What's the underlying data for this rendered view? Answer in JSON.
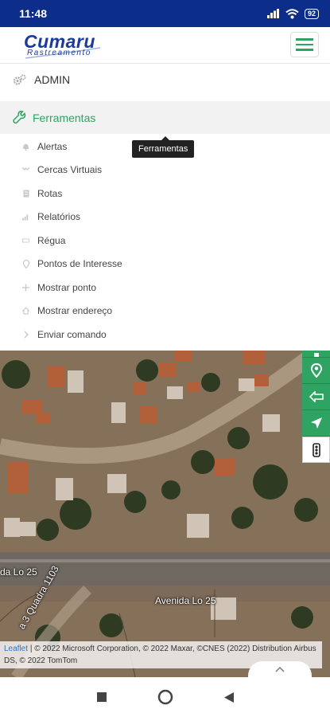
{
  "status": {
    "time": "11:48",
    "battery": "92"
  },
  "header": {
    "logo_main": "Cumaru",
    "logo_sub": "Rastreamento"
  },
  "menu": {
    "admin_label": "ADMIN",
    "tools_label": "Ferramentas",
    "tooltip": "Ferramentas",
    "items": [
      {
        "label": "Alertas",
        "icon": "bell-icon"
      },
      {
        "label": "Cercas Virtuais",
        "icon": "fence-icon"
      },
      {
        "label": "Rotas",
        "icon": "route-icon"
      },
      {
        "label": "Relatórios",
        "icon": "chart-icon"
      },
      {
        "label": "Régua",
        "icon": "ruler-icon"
      },
      {
        "label": "Pontos de Interesse",
        "icon": "pin-icon"
      },
      {
        "label": "Mostrar ponto",
        "icon": "crosshair-icon"
      },
      {
        "label": "Mostrar endereço",
        "icon": "home-icon"
      },
      {
        "label": "Enviar comando",
        "icon": "chevron-right-icon"
      }
    ]
  },
  "map": {
    "street_label_1": "da Lo 25",
    "street_label_2": "Avenida Lo 25",
    "street_label_3": "a 3 Quadra 1103",
    "attribution_link": "Leaflet",
    "attribution_text": "| © 2022 Microsoft Corporation, © 2022 Maxar, ©CNES (2022) Distribution Airbus DS, © 2022 TomTom"
  },
  "colors": {
    "brand_blue": "#1b3a9c",
    "accent_green": "#2fa361",
    "status_bar": "#0d2d8a"
  }
}
